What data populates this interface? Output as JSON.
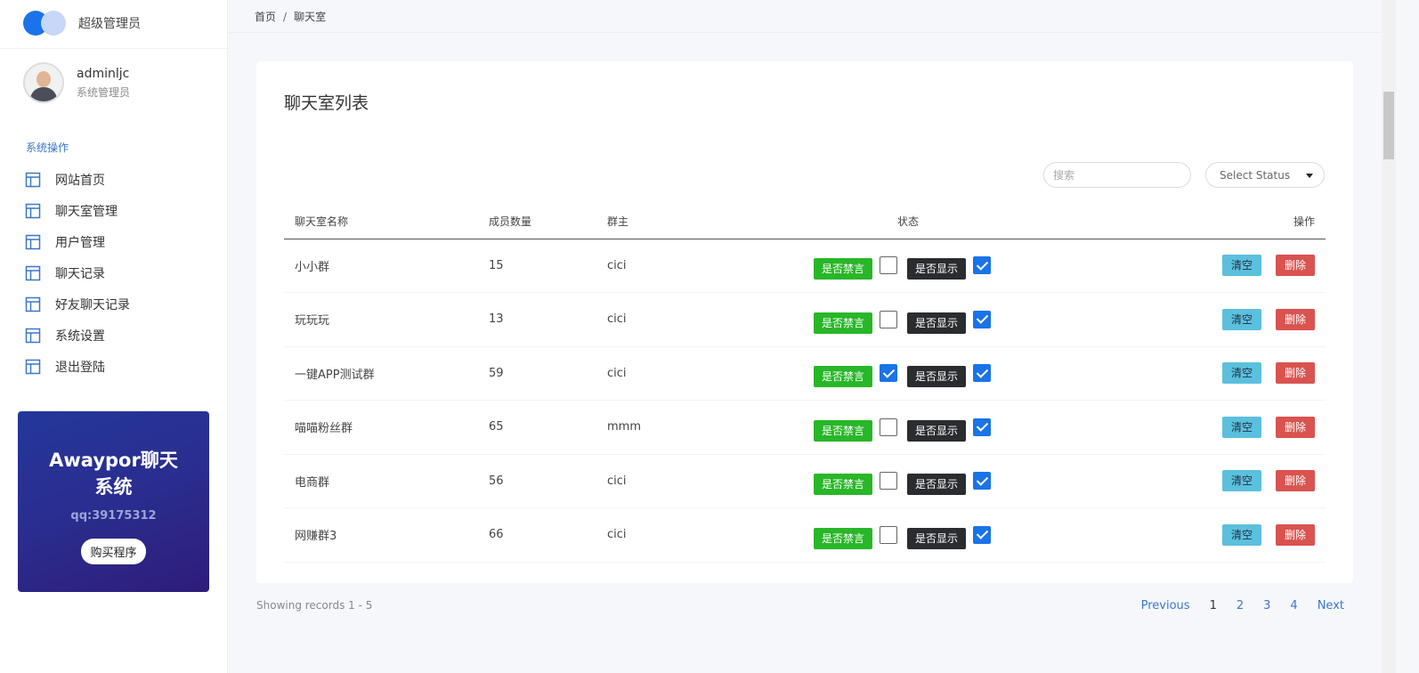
{
  "brand": {
    "name": "超级管理员"
  },
  "user": {
    "name": "adminljc",
    "role": "系统管理员"
  },
  "nav": {
    "title": "系统操作",
    "items": [
      {
        "label": "网站首页"
      },
      {
        "label": "聊天室管理"
      },
      {
        "label": "用户管理"
      },
      {
        "label": "聊天记录"
      },
      {
        "label": "好友聊天记录"
      },
      {
        "label": "系统设置"
      },
      {
        "label": "退出登陆"
      }
    ]
  },
  "promo": {
    "title": "Awaypor聊天系统",
    "qq": "qq:39175312",
    "button": "购买程序"
  },
  "breadcrumb": {
    "home": "首页",
    "sep": "/",
    "current": "聊天室"
  },
  "card": {
    "title": "聊天室列表"
  },
  "filters": {
    "search_placeholder": "搜索",
    "status_select": "Select Status"
  },
  "table": {
    "headers": {
      "name": "聊天室名称",
      "count": "成员数量",
      "owner": "群主",
      "status": "状态",
      "ops": "操作"
    },
    "mute_label": "是否禁言",
    "show_label": "是否显示",
    "clear_label": "清空",
    "delete_label": "删除",
    "rows": [
      {
        "name": "小小群",
        "count": "15",
        "owner": "cici",
        "muted": false,
        "shown": true
      },
      {
        "name": "玩玩玩",
        "count": "13",
        "owner": "cici",
        "muted": false,
        "shown": true
      },
      {
        "name": "一键APP测试群",
        "count": "59",
        "owner": "cici",
        "muted": true,
        "shown": true
      },
      {
        "name": "喵喵粉丝群",
        "count": "65",
        "owner": "mmm",
        "muted": false,
        "shown": true
      },
      {
        "name": "电商群",
        "count": "56",
        "owner": "cici",
        "muted": false,
        "shown": true
      },
      {
        "name": "网赚群3",
        "count": "66",
        "owner": "cici",
        "muted": false,
        "shown": true
      }
    ]
  },
  "footer": {
    "info": "Showing records 1 - 5"
  },
  "pagination": {
    "previous": "Previous",
    "pages": [
      "1",
      "2",
      "3",
      "4"
    ],
    "next": "Next",
    "active": "1"
  },
  "colors": {
    "accent": "#1a73e8",
    "mute_tag": "#28b728",
    "show_tag": "#2b2c30",
    "clear_btn": "#5bc0de",
    "delete_btn": "#d9534f"
  }
}
